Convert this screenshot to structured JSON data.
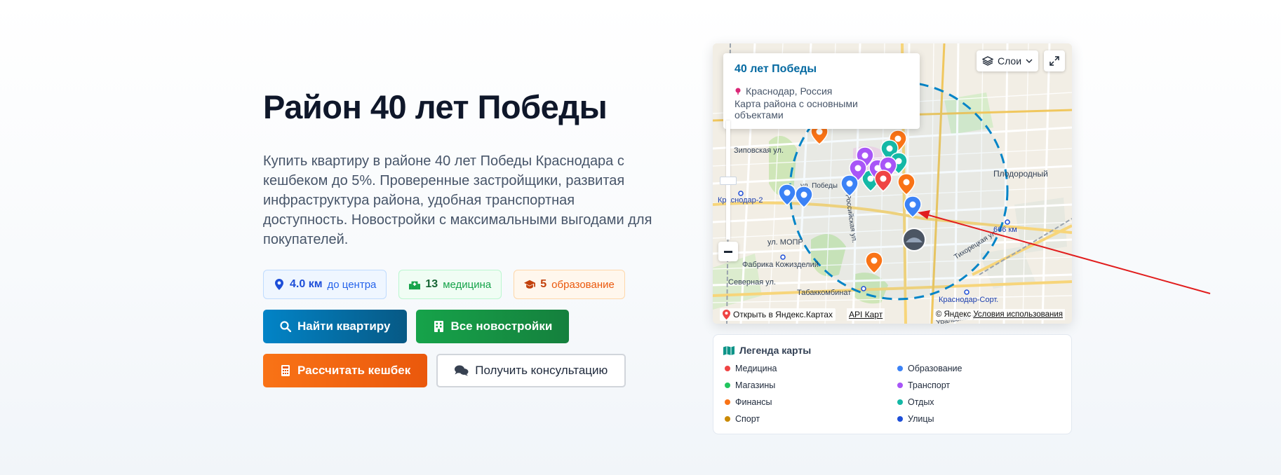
{
  "hero": {
    "title": "Район 40 лет Победы",
    "description": "Купить квартиру в районе 40 лет Победы Краснодара с кешбеком до 5%. Проверенные застройщики, развитая инфраструктура района, удобная транспортная доступность. Новостройки с максимальными выгодами для покупателей.",
    "badges": [
      {
        "value": "4.0 км",
        "label": "до центра",
        "icon": "map-pin-icon"
      },
      {
        "value": "13",
        "label": "медицина",
        "icon": "hospital-icon"
      },
      {
        "value": "5",
        "label": "образование",
        "icon": "graduation-cap-icon"
      }
    ],
    "buttons": {
      "find": "Найти квартиру",
      "all": "Все новостройки",
      "calc": "Рассчитать кешбек",
      "consult": "Получить консультацию"
    }
  },
  "map": {
    "popup": {
      "title": "40 лет Победы",
      "location": "Краснодар, Россия",
      "description": "Карта района с основными объектами"
    },
    "layers_label": "Слои",
    "open_link": "Открыть в Яндекс.Картах",
    "api_link": "API Карт",
    "copyright": "© Яндекс",
    "terms": "Условия использования",
    "labels": {
      "zipovskaya": "Зиповская ул.",
      "krasnodar2": "Краснодар-2",
      "plodorodny": "Плодородный",
      "km666": "666 км",
      "mopr": "ул. МОПР",
      "fabrika": "Фабрика Кожизделий",
      "severnaya": "Северная ул.",
      "tabak": "Табаккомбинат",
      "krasnodar_sort": "Краснодар-Сорт.",
      "tikhoretskaya": "Тихорецкая ул.",
      "uralskaya": "Уральская ул.",
      "rossiyskaya": "Российская ул.",
      "pobedy": "ул. Победы",
      "kirova": "Кир... ул."
    }
  },
  "legend": {
    "title": "Легенда карты",
    "items": [
      {
        "label": "Медицина",
        "color": "#ef4444"
      },
      {
        "label": "Образование",
        "color": "#3b82f6"
      },
      {
        "label": "Магазины",
        "color": "#22c55e"
      },
      {
        "label": "Транспорт",
        "color": "#a855f7"
      },
      {
        "label": "Финансы",
        "color": "#f97316"
      },
      {
        "label": "Отдых",
        "color": "#14b8a6"
      },
      {
        "label": "Спорт",
        "color": "#ca8a04"
      },
      {
        "label": "Улицы",
        "color": "#1d4ed8"
      }
    ]
  },
  "colors": {
    "accent_blue": "#0284c7",
    "accent_green": "#16a34a",
    "accent_orange": "#f97316",
    "arrow_red": "#e11d1d"
  }
}
